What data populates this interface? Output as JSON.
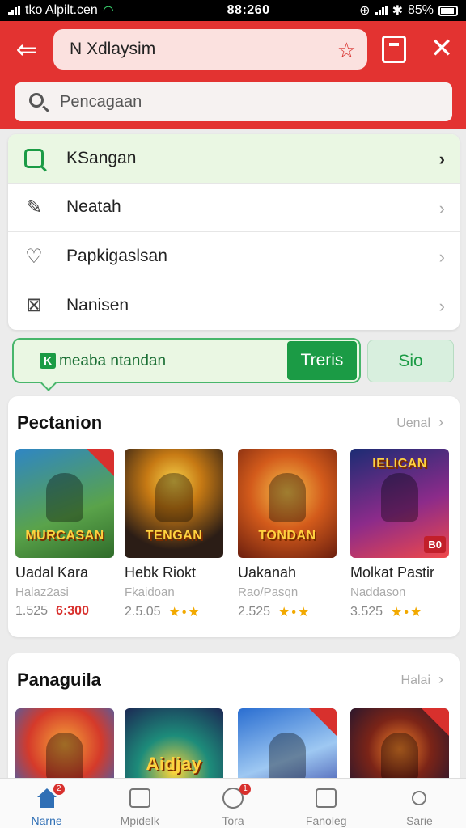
{
  "status_bar": {
    "carrier": "tko Alpilt.cen",
    "time": "88:260",
    "battery": "85%"
  },
  "header": {
    "title": "N Xdlaysim",
    "search_placeholder": "Pencagaan"
  },
  "menu": {
    "items": [
      {
        "label": "KSangan",
        "icon": "search-square-icon",
        "active": true
      },
      {
        "label": "Neatah",
        "icon": "brush-icon",
        "active": false
      },
      {
        "label": "Papkigaslsan",
        "icon": "heart-icon",
        "active": false
      },
      {
        "label": "Nanisen",
        "icon": "box-icon",
        "active": false
      }
    ]
  },
  "promo": {
    "text": "meaba ntandan",
    "button_label": "Treris",
    "secondary_label": "Sio"
  },
  "section1": {
    "title": "Pectanion",
    "see_all": "Uenal",
    "games": [
      {
        "name": "Uadal Kara",
        "dev": "Halaz2asi",
        "rating": "1.525",
        "price": "6:300",
        "art": "MURCASAN"
      },
      {
        "name": "Hebk Riokt",
        "dev": "Fkaidoan",
        "rating": "2.5.05",
        "price": "",
        "art": "TENGAN"
      },
      {
        "name": "Uakanah",
        "dev": "Rao/Pasqn",
        "rating": "2.525",
        "price": "",
        "art": "TONDAN"
      },
      {
        "name": "Molkat Pastir",
        "dev": "Naddason",
        "rating": "3.525",
        "price": "",
        "art": "IELICAN"
      }
    ]
  },
  "section2": {
    "title": "Panaguila",
    "see_all": "Halai",
    "games": [
      {
        "art": ""
      },
      {
        "art": "Aidjay"
      },
      {
        "art": ""
      },
      {
        "art": ""
      }
    ]
  },
  "bottom_nav": {
    "items": [
      {
        "label": "Narne",
        "active": true
      },
      {
        "label": "Mpidelk",
        "active": false
      },
      {
        "label": "Tora",
        "active": false
      },
      {
        "label": "Fanoleg",
        "active": false
      },
      {
        "label": "Sarie",
        "active": false
      }
    ]
  },
  "colors": {
    "brand_red": "#e33331",
    "accent_green": "#1b9b45",
    "nav_active": "#2f6fb5"
  }
}
